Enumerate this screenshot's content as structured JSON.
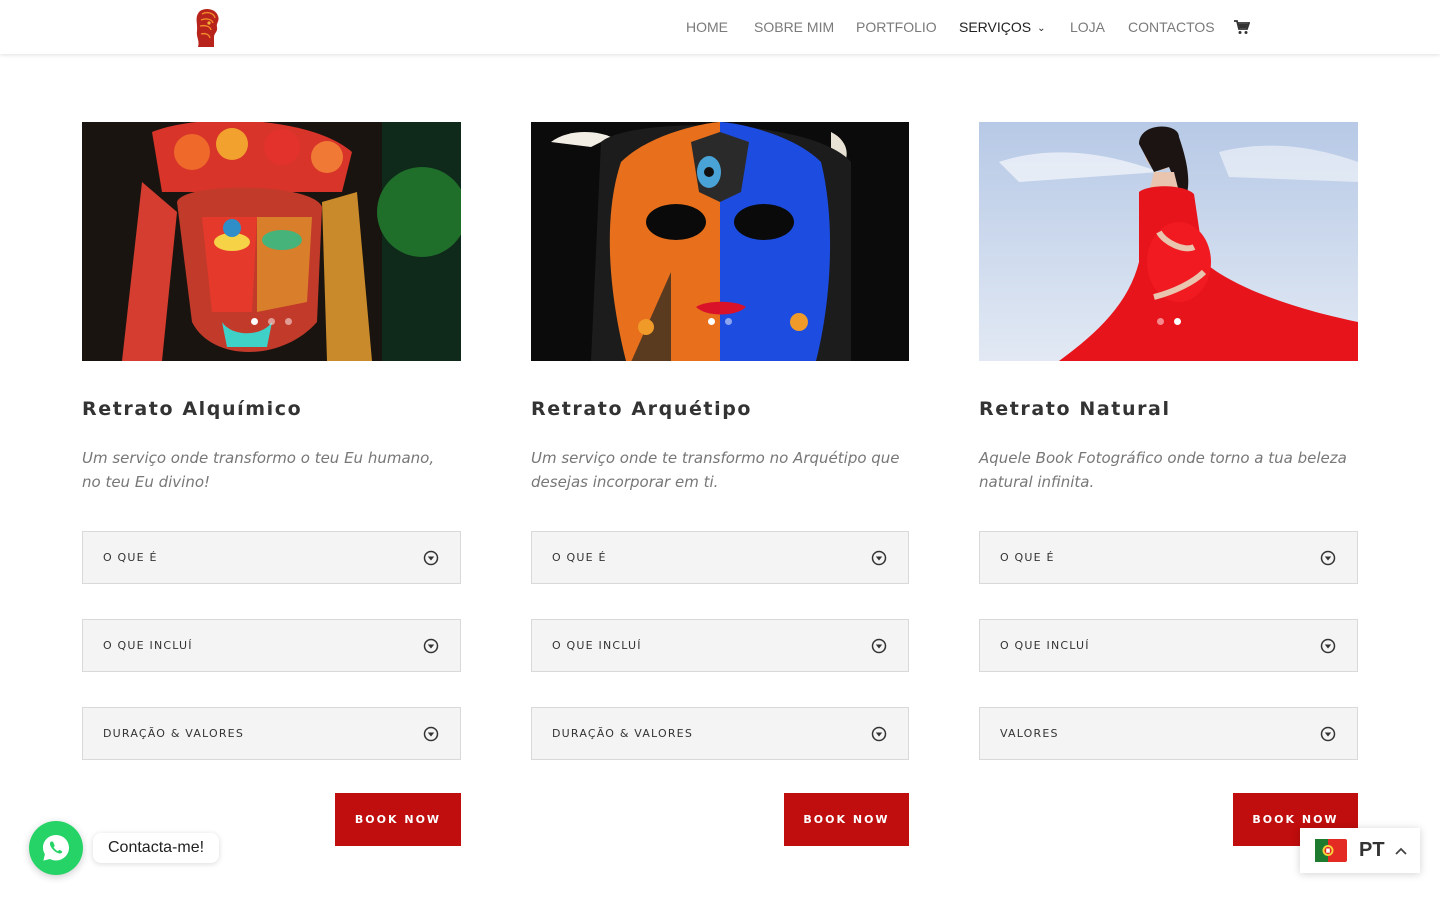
{
  "header": {
    "nav": [
      {
        "label": "HOME"
      },
      {
        "label": "SOBRE MIM"
      },
      {
        "label": "PORTFOLIO"
      },
      {
        "label": "SERVIÇOS",
        "active": true,
        "has_dropdown": true
      },
      {
        "label": "LOJA"
      },
      {
        "label": "CONTACTOS"
      }
    ],
    "cart_icon": "shopping-cart-icon",
    "logo_icon": "red-head-profile-logo"
  },
  "services": [
    {
      "title": "Retrato Alquímico",
      "description": "Um serviço onde transformo o teu Eu humano, no teu Eu divino!",
      "slider_dots": 3,
      "active_dot": 1,
      "toggles": [
        "O QUE É",
        "O QUE INCLUÍ",
        "DURAÇÃO & VALORES"
      ],
      "button": "BOOK NOW"
    },
    {
      "title": "Retrato Arquétipo",
      "description": "Um serviço onde te transformo no Arquétipo que desejas incorporar em ti.",
      "slider_dots": 2,
      "active_dot": 1,
      "toggles": [
        "O QUE É",
        "O QUE INCLUÍ",
        "DURAÇÃO & VALORES"
      ],
      "button": "BOOK NOW"
    },
    {
      "title": "Retrato Natural",
      "description": "Aquele Book Fotográfico onde torno a tua beleza natural infinita.",
      "slider_dots": 2,
      "active_dot": 2,
      "toggles": [
        "O QUE É",
        "O QUE INCLUÍ",
        "VALORES"
      ],
      "button": "BOOK NOW"
    }
  ],
  "whatsapp": {
    "label": "Contacta-me!",
    "icon": "whatsapp-icon"
  },
  "language": {
    "code": "PT",
    "flag": "portugal-flag-icon"
  },
  "colors": {
    "accent": "#c00d0d",
    "whatsapp": "#25d366",
    "toggle_bg": "#f4f4f4"
  }
}
